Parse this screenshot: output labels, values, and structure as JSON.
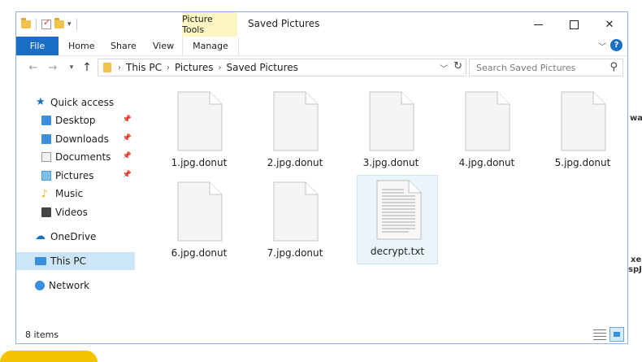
{
  "window": {
    "title": "Saved Pictures",
    "context_tab": "Picture Tools"
  },
  "ribbon": {
    "tabs": [
      "File",
      "Home",
      "Share",
      "View",
      "Manage"
    ],
    "help": "?"
  },
  "navigation": {
    "breadcrumb": [
      "This PC",
      "Pictures",
      "Saved Pictures"
    ],
    "search_placeholder": "Search Saved Pictures"
  },
  "sidebar": {
    "items": [
      {
        "label": "Quick access",
        "icon": "star-icon"
      },
      {
        "label": "Desktop",
        "icon": "desktop-icon",
        "pinned": true
      },
      {
        "label": "Downloads",
        "icon": "downloads-icon",
        "pinned": true
      },
      {
        "label": "Documents",
        "icon": "documents-icon",
        "pinned": true
      },
      {
        "label": "Pictures",
        "icon": "pictures-icon",
        "pinned": true
      },
      {
        "label": "Music",
        "icon": "music-icon"
      },
      {
        "label": "Videos",
        "icon": "videos-icon"
      },
      {
        "label": "OneDrive",
        "icon": "cloud-icon"
      },
      {
        "label": "This PC",
        "icon": "computer-icon",
        "selected": true
      },
      {
        "label": "Network",
        "icon": "network-icon"
      }
    ]
  },
  "files": [
    {
      "name": "1.jpg.donut",
      "kind": "blank"
    },
    {
      "name": "2.jpg.donut",
      "kind": "blank"
    },
    {
      "name": "3.jpg.donut",
      "kind": "blank"
    },
    {
      "name": "4.jpg.donut",
      "kind": "blank"
    },
    {
      "name": "5.jpg.donut",
      "kind": "blank"
    },
    {
      "name": "6.jpg.donut",
      "kind": "blank"
    },
    {
      "name": "7.jpg.donut",
      "kind": "blank"
    },
    {
      "name": "decrypt.txt",
      "kind": "text",
      "selected": true
    }
  ],
  "status": {
    "count": "8 items"
  },
  "background_fragments": [
    "war",
    "xe",
    "spJ"
  ]
}
